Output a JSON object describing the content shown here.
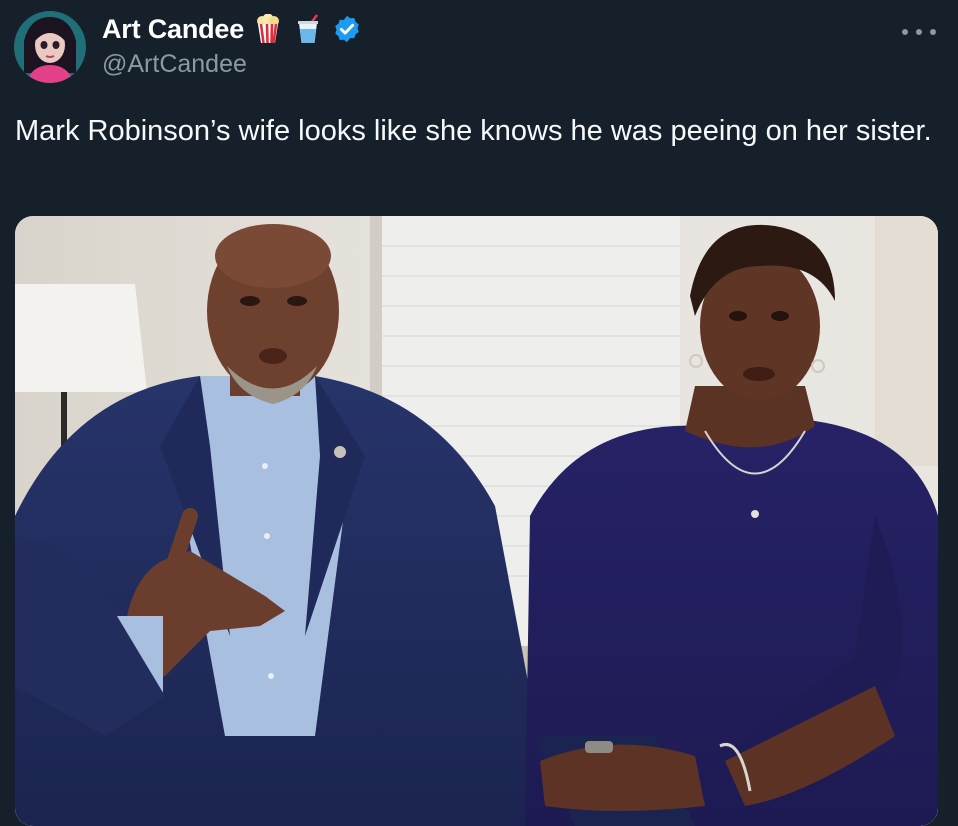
{
  "tweet": {
    "author": {
      "display_name": "Art Candee",
      "handle": "@ArtCandee",
      "badges": [
        "popcorn-icon",
        "cup-with-straw-icon",
        "verified-badge-icon"
      ],
      "verified_color": "#1d9bf0"
    },
    "more_menu_icon": "more-options-icon",
    "text": "Mark Robinson’s wife looks like she knows he was peeing on her sister.",
    "media": {
      "type": "photo"
    }
  },
  "colors": {
    "background": "#15202b",
    "text_primary": "#f7f9f9",
    "text_secondary": "#8b98a5"
  }
}
